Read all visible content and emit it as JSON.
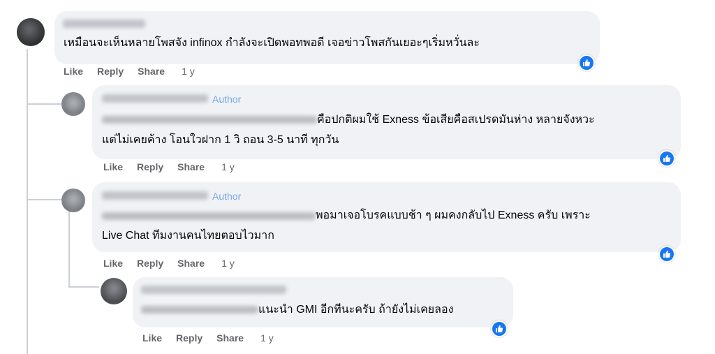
{
  "comments": [
    {
      "author_name": "Xxs Fuse Yosn",
      "text_lines": [
        "เหมือนจะเห็นหลายโพสจัง infinox กำลังจะเปิดพอทพอดี เจอข่าวโพสกันเยอะๆเริ่มหวั่นละ"
      ],
      "like": "Like",
      "reply": "Reply",
      "share": "Share",
      "time": "1 y",
      "reaction_icon": "like-thumb-icon"
    },
    {
      "author_name": "Author name",
      "author_badge": "Author",
      "text_lines": [
        "คือปกติผมใช้ Exness ข้อเสียคือสเปรดมันห่าง หลายจังหวะ",
        "แต่ไม่เคยค้าง โอนใวฝาก 1 วิ ถอน 3-5 นาที ทุกวัน"
      ],
      "like": "Like",
      "reply": "Reply",
      "share": "Share",
      "time": "1 y",
      "reaction_icon": "like-thumb-icon"
    },
    {
      "author_name": "Author name",
      "author_badge": "Author",
      "text_lines": [
        "พอมาเจอโบรคแบบช้า ๆ ผมคงกลับไป Exness ครับ เพราะ",
        "Live Chat ทีมงานคนไทยตอบไวมาก"
      ],
      "like": "Like",
      "reply": "Reply",
      "share": "Share",
      "time": "1 y",
      "reaction_icon": "like-thumb-icon"
    },
    {
      "author_name": "Reply user",
      "text_lines": [
        "แนะนำ GMI อีกทีนะครับ ถ้ายังไม่เคยลอง"
      ],
      "like": "Like",
      "reply": "Reply",
      "share": "Share",
      "time": "1 y",
      "reaction_icon": "like-thumb-icon"
    }
  ],
  "colors": {
    "like_blue": "#1877f2",
    "bubble_bg": "#f0f2f5",
    "meta_gray": "#65676b",
    "author_badge": "#7aa7e0"
  }
}
